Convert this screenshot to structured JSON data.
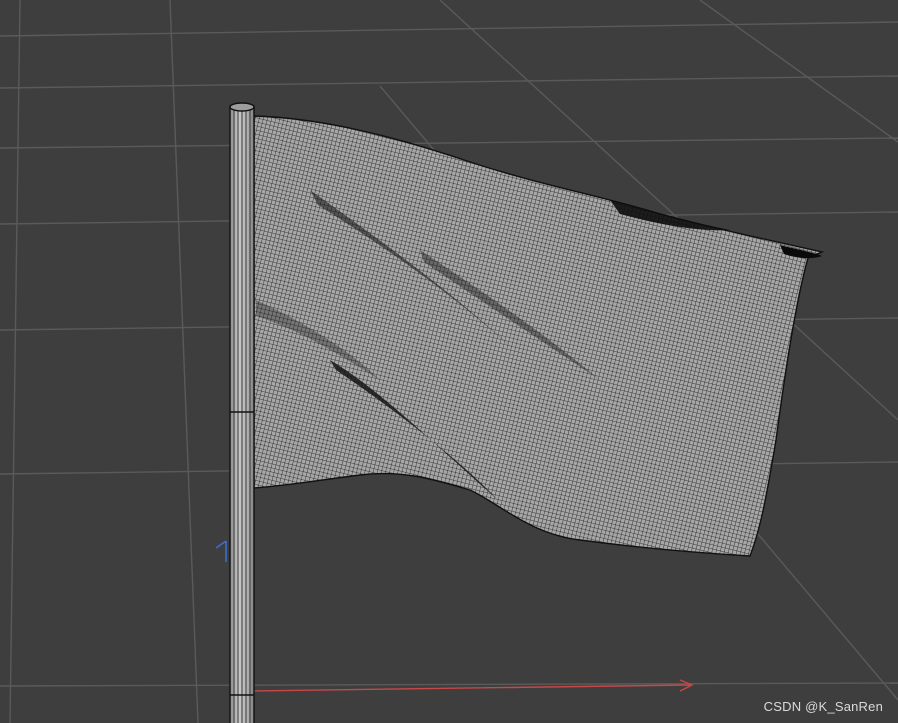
{
  "viewport": {
    "background_color": "#3e3e3e",
    "grid_line_color": "#5b5b5b",
    "wire_color": "#0a0a0a",
    "cloth_color": "#a7a7a7",
    "pole_color": "#b4b4b4",
    "axis_x_color": "#c64848",
    "axis_z_color": "#3a6fd0"
  },
  "scene": {
    "objects": [
      "flag-pole",
      "cloth-flag"
    ],
    "shading": "wireframe"
  },
  "watermark": {
    "text": "CSDN @K_SanRen"
  }
}
